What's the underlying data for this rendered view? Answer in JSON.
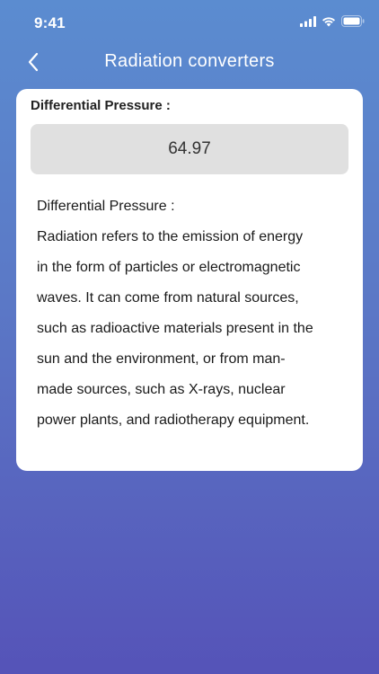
{
  "status_bar": {
    "time": "9:41",
    "icons": [
      "signal-icon",
      "wifi-icon",
      "battery-icon"
    ]
  },
  "header": {
    "back_icon": "chevron-left-icon",
    "title": "Radiation converters"
  },
  "card": {
    "field_label": "Differential Pressure :",
    "value": "64.97",
    "description_heading": "Differential Pressure :",
    "description_lines": [
      "Radiation refers to the emission of energy",
      "in the form of particles or electromagnetic",
      "waves. It can come from natural sources,",
      "such as radioactive materials present in the",
      "sun and the environment, or from man-",
      "made sources, such as X-rays, nuclear",
      "power plants, and radiotherapy equipment."
    ]
  },
  "colors": {
    "gradient_top": "#5b8cd0",
    "gradient_bottom": "#5553b8",
    "card_background": "#ffffff",
    "value_box": "#e0e0e0"
  }
}
